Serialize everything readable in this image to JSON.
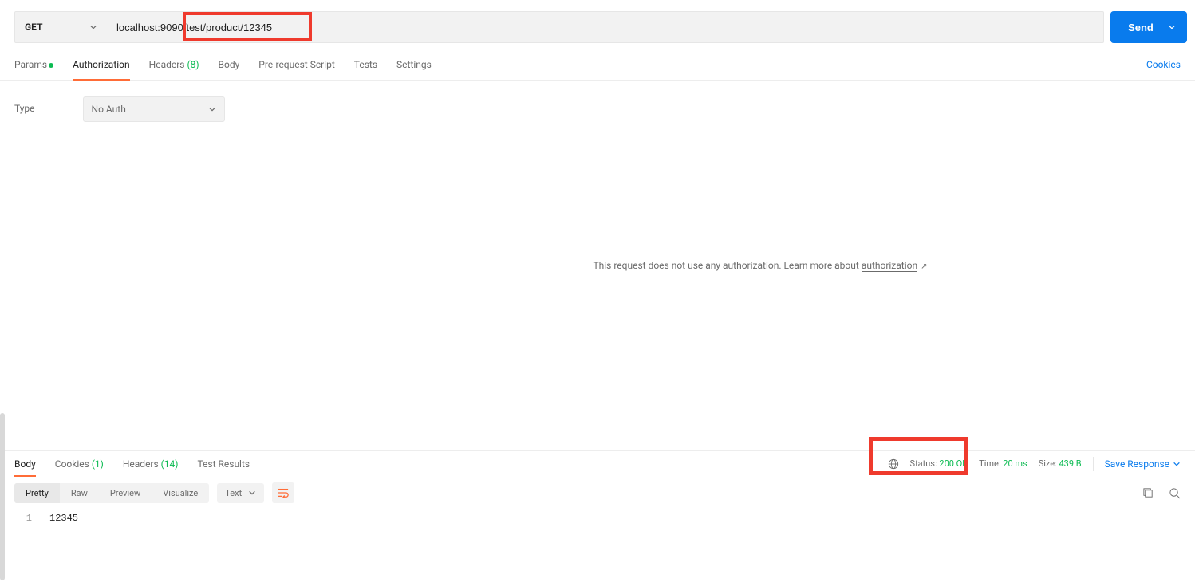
{
  "request": {
    "method": "GET",
    "url_prefix": "localhost:9090",
    "url_path": "/test/product/12345",
    "send_label": "Send"
  },
  "request_tabs": {
    "params": "Params",
    "authorization": "Authorization",
    "headers": "Headers",
    "headers_count": "(8)",
    "body": "Body",
    "prerequest": "Pre-request Script",
    "tests": "Tests",
    "settings": "Settings",
    "cookies_link": "Cookies"
  },
  "auth": {
    "type_label": "Type",
    "type_value": "No Auth",
    "info_text": "This request does not use any authorization. Learn more about ",
    "info_link": "authorization"
  },
  "response_tabs": {
    "body": "Body",
    "cookies": "Cookies",
    "cookies_count": "(1)",
    "headers": "Headers",
    "headers_count": "(14)",
    "test_results": "Test Results"
  },
  "response_meta": {
    "status_label": "Status:",
    "status_value": "200 OK",
    "time_label": "Time:",
    "time_value": "20 ms",
    "size_label": "Size:",
    "size_value": "439 B",
    "save_response": "Save Response"
  },
  "view_modes": {
    "pretty": "Pretty",
    "raw": "Raw",
    "preview": "Preview",
    "visualize": "Visualize",
    "lang": "Text"
  },
  "response_body": {
    "line1_no": "1",
    "line1_content": "12345"
  }
}
